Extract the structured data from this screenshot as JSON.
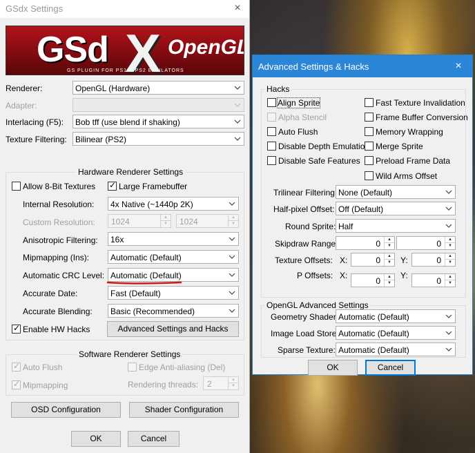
{
  "gsdx": {
    "title": "GSdx Settings",
    "close_icon": "×",
    "banner": {
      "gs": "GSd",
      "x": "X",
      "opengl": "OpenGL",
      "subtitle": "GS PLUGIN FOR PS1 & PS2 EMULATORS"
    },
    "renderer": {
      "label": "Renderer:",
      "value": "OpenGL (Hardware)"
    },
    "adapter": {
      "label": "Adapter:",
      "value": ""
    },
    "interlacing": {
      "label": "Interlacing (F5):",
      "value": "Bob tff (use blend if shaking)"
    },
    "texture_filtering": {
      "label": "Texture Filtering:",
      "value": "Bilinear (PS2)"
    },
    "hw": {
      "title": "Hardware Renderer Settings",
      "allow_8bit": {
        "label": "Allow 8-Bit Textures",
        "checked": false
      },
      "large_fb": {
        "label": "Large Framebuffer",
        "checked": true
      },
      "internal_res": {
        "label": "Internal Resolution:",
        "value": "4x Native (~1440p 2K)"
      },
      "custom_res": {
        "label": "Custom Resolution:",
        "w": "1024",
        "h": "1024"
      },
      "aniso": {
        "label": "Anisotropic Filtering:",
        "value": "16x"
      },
      "mipmapping": {
        "label": "Mipmapping (Ins):",
        "value": "Automatic (Default)"
      },
      "crc": {
        "label": "Automatic CRC Level:",
        "value": "Automatic (Default)"
      },
      "acc_date": {
        "label": "Accurate Date:",
        "value": "Fast (Default)"
      },
      "acc_blend": {
        "label": "Accurate Blending:",
        "value": "Basic (Recommended)"
      },
      "enable_hacks": {
        "label": "Enable HW Hacks",
        "checked": true
      },
      "adv_button": "Advanced Settings and Hacks"
    },
    "sw": {
      "title": "Software Renderer Settings",
      "auto_flush": {
        "label": "Auto Flush",
        "checked": true
      },
      "edge_aa": {
        "label": "Edge Anti-aliasing (Del)",
        "checked": false
      },
      "mipmapping": {
        "label": "Mipmapping",
        "checked": true
      },
      "threads": {
        "label": "Rendering threads:",
        "value": "2"
      }
    },
    "osd_button": "OSD Configuration",
    "shader_button": "Shader Configuration",
    "ok": "OK",
    "cancel": "Cancel"
  },
  "adv": {
    "title": "Advanced Settings & Hacks",
    "close_icon": "×",
    "hacks": {
      "title": "Hacks",
      "align_sprite": {
        "label": "Align Sprite",
        "checked": false
      },
      "alpha_stencil": {
        "label": "Alpha Stencil",
        "checked": false
      },
      "auto_flush": {
        "label": "Auto Flush",
        "checked": false
      },
      "disable_depth": {
        "label": "Disable Depth Emulation",
        "checked": false
      },
      "disable_safe": {
        "label": "Disable Safe Features",
        "checked": false
      },
      "fast_tex": {
        "label": "Fast Texture Invalidation",
        "checked": false
      },
      "fb_conv": {
        "label": "Frame Buffer Conversion",
        "checked": false
      },
      "mem_wrap": {
        "label": "Memory Wrapping",
        "checked": false
      },
      "merge_sprite": {
        "label": "Merge Sprite",
        "checked": false
      },
      "preload": {
        "label": "Preload Frame Data",
        "checked": false
      },
      "wild_arms": {
        "label": "Wild Arms Offset",
        "checked": false
      },
      "trilinear": {
        "label": "Trilinear Filtering:",
        "value": "None (Default)"
      },
      "half_pixel": {
        "label": "Half-pixel Offset:",
        "value": "Off (Default)"
      },
      "round_sprite": {
        "label": "Round Sprite:",
        "value": "Half"
      },
      "skipdraw": {
        "label": "Skipdraw Range:",
        "a": "0",
        "b": "0"
      },
      "tex_offsets": {
        "label": "Texture Offsets:",
        "x_label": "X:",
        "x": "0",
        "y_label": "Y:",
        "y": "0"
      },
      "p_offsets": {
        "label": "P Offsets:",
        "x_label": "X:",
        "x": "0",
        "y_label": "Y:",
        "y": "0"
      }
    },
    "ogl": {
      "title": "OpenGL Advanced Settings",
      "geometry": {
        "label": "Geometry Shader:",
        "value": "Automatic (Default)"
      },
      "image_load": {
        "label": "Image Load Store:",
        "value": "Automatic (Default)"
      },
      "sparse": {
        "label": "Sparse Texture:",
        "value": "Automatic (Default)"
      }
    },
    "ok": "OK",
    "cancel": "Cancel"
  },
  "colors": {
    "accent": "#0078d7",
    "underline": "#d01818",
    "titlebar_active": "#2b86d8"
  }
}
